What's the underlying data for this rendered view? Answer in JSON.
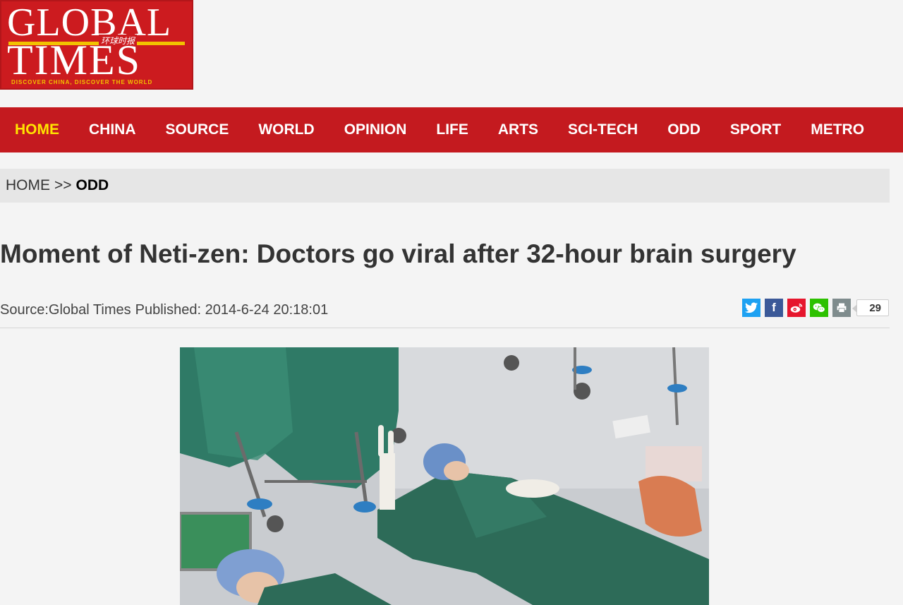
{
  "logo": {
    "line1": "GLOBAL",
    "line2": "TIMES",
    "chinese": "环球时报",
    "tagline": "DISCOVER CHINA, DISCOVER THE WORLD"
  },
  "nav": {
    "items": [
      {
        "label": "HOME",
        "active": true
      },
      {
        "label": "CHINA"
      },
      {
        "label": "SOURCE"
      },
      {
        "label": "WORLD"
      },
      {
        "label": "OPINION"
      },
      {
        "label": "LIFE"
      },
      {
        "label": "ARTS"
      },
      {
        "label": "SCI-TECH"
      },
      {
        "label": "ODD"
      },
      {
        "label": "SPORT"
      },
      {
        "label": "METRO"
      }
    ]
  },
  "breadcrumb": {
    "home": "HOME",
    "separator": ">>",
    "current": "ODD"
  },
  "article": {
    "title": "Moment of Neti-zen: Doctors go viral after 32-hour brain surgery",
    "source": "Source:Global Times",
    "published": "Published: 2014-6-24 20:18:01",
    "image_description_icon": "photo-icon"
  },
  "share": {
    "icons": [
      "twitter-icon",
      "facebook-icon",
      "weibo-icon",
      "wechat-icon",
      "print-icon"
    ],
    "count": "29"
  },
  "colors": {
    "brand_red": "#c41a1f",
    "active_nav": "#ffe400",
    "background": "#f4f4f4"
  }
}
